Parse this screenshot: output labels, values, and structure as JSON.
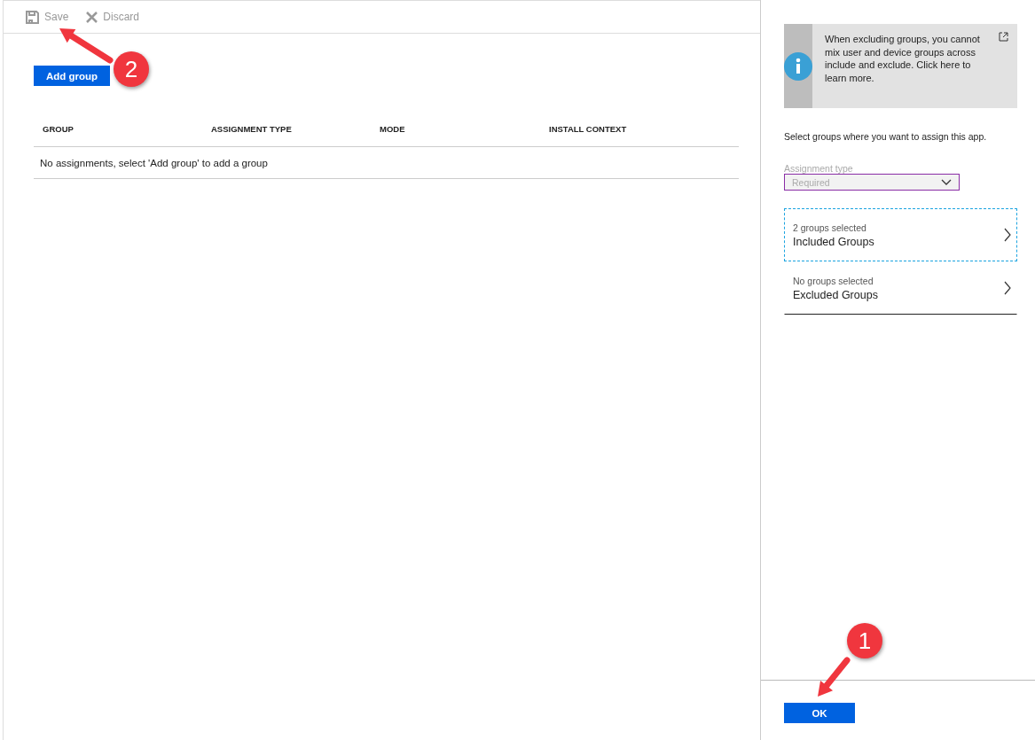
{
  "toolbar": [
    {
      "label": "Save",
      "kind": "save",
      "disabled": true
    },
    {
      "label": "Discard",
      "kind": "discard",
      "disabled": true
    }
  ],
  "add_button": "Add group",
  "table": {
    "columns": [
      "GROUP",
      "ASSIGNMENT TYPE",
      "MODE",
      "INSTALL CONTEXT"
    ],
    "empty_message": "No assignments, select 'Add group' to add a group"
  },
  "info_banner": {
    "text": "When excluding groups, you cannot mix user and device groups across include and exclude.  Click here to learn more."
  },
  "instruction": "Select groups where you want to assign this app.",
  "assignment_type": {
    "label": "Assignment type",
    "value": "Required",
    "disabled": true
  },
  "group_rows": [
    {
      "caption": "2 groups selected",
      "title": "Included Groups",
      "selected": true
    },
    {
      "caption": "No groups selected",
      "title": "Excluded Groups",
      "selected": false
    }
  ],
  "ok_button": "OK",
  "callouts": [
    {
      "number": "2"
    },
    {
      "number": "1"
    }
  ]
}
